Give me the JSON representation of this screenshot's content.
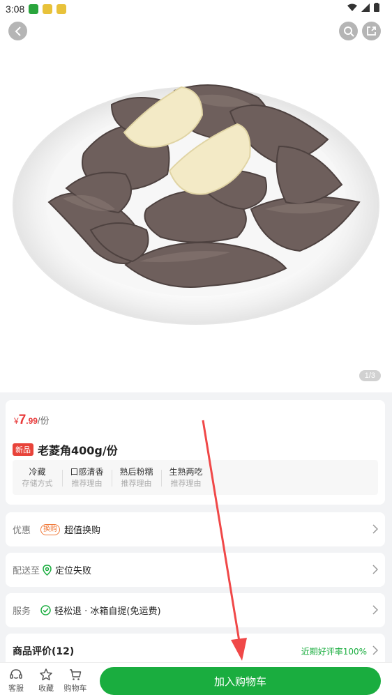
{
  "status_bar": {
    "time": "3:08",
    "app_icons": [
      "aisen-app-icon",
      "game-app-icon",
      "game-app-icon"
    ]
  },
  "hero": {
    "image_counter": "1/3"
  },
  "product": {
    "price": {
      "symbol": "¥",
      "integer": "7",
      "decimal": ".99",
      "unit": "/份"
    },
    "badge": "新品",
    "title": "老菱角400g/份",
    "attributes": [
      {
        "value": "冷藏",
        "key": "存储方式"
      },
      {
        "value": "口感清香",
        "key": "推荐理由"
      },
      {
        "value": "熟后粉糯",
        "key": "推荐理由"
      },
      {
        "value": "生熟两吃",
        "key": "推荐理由"
      }
    ]
  },
  "promo": {
    "label": "优惠",
    "badge": "换购",
    "text": "超值换购"
  },
  "delivery": {
    "label": "配送至",
    "text": "定位失败"
  },
  "service": {
    "label": "服务",
    "text": "轻松退 · 冰箱自提(免运费)"
  },
  "reviews": {
    "title": "商品评价(12)",
    "rate": "近期好评率100%"
  },
  "bottom_bar": {
    "tabs": [
      {
        "label": "客服",
        "icon": "customer-service-icon"
      },
      {
        "label": "收藏",
        "icon": "star-icon"
      },
      {
        "label": "购物车",
        "icon": "cart-icon"
      }
    ],
    "add_to_cart": "加入购物车"
  },
  "colors": {
    "accent_green": "#1aad3f",
    "price_red": "#e83a3a",
    "annotation_red": "#f04848"
  }
}
